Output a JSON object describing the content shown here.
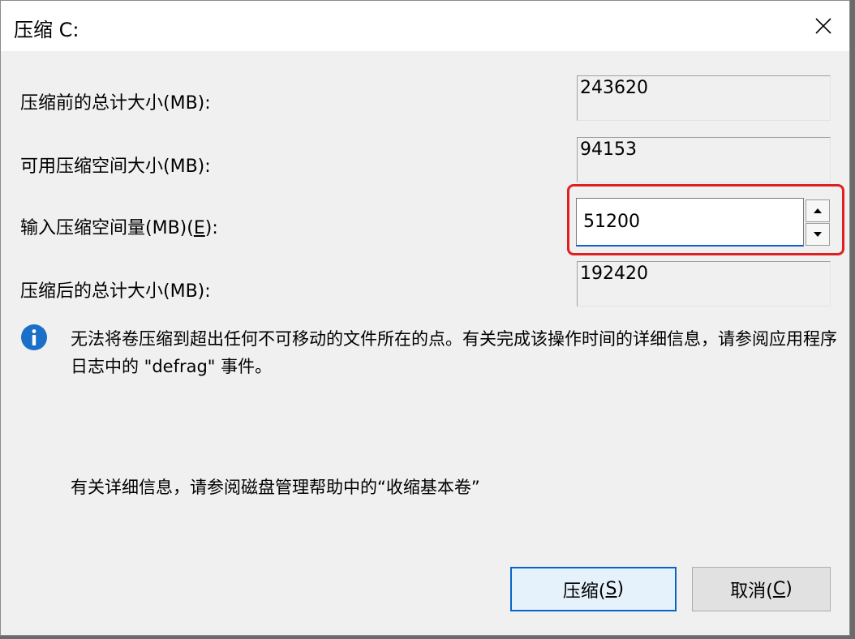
{
  "window": {
    "title": "压缩 C:"
  },
  "fields": {
    "total_before": {
      "label": "压缩前的总计大小(MB):",
      "value": "243620"
    },
    "available": {
      "label": "可用压缩空间大小(MB):",
      "value": "94153"
    },
    "shrink_amount": {
      "label_prefix": "输入压缩空间量(MB)(",
      "label_key": "E",
      "label_suffix": "):",
      "value": "51200"
    },
    "total_after": {
      "label": "压缩后的总计大小(MB):",
      "value": "192420"
    }
  },
  "info": {
    "message": "无法将卷压缩到超出任何不可移动的文件所在的点。有关完成该操作时间的详细信息，请参阅应用程序日志中的 \"defrag\" 事件。",
    "help": "有关详细信息，请参阅磁盘管理帮助中的“收缩基本卷”"
  },
  "buttons": {
    "shrink": {
      "label": "压缩(",
      "key": "S",
      "suffix": ")"
    },
    "cancel": {
      "label": "取消(",
      "key": "C",
      "suffix": ")"
    }
  },
  "colors": {
    "highlight": "#e02020",
    "accent": "#0a64c8",
    "info": "#1a6fc9"
  },
  "icons": {
    "close": "close-icon",
    "info": "info-icon",
    "spin_up": "chevron-up-icon",
    "spin_down": "chevron-down-icon"
  }
}
